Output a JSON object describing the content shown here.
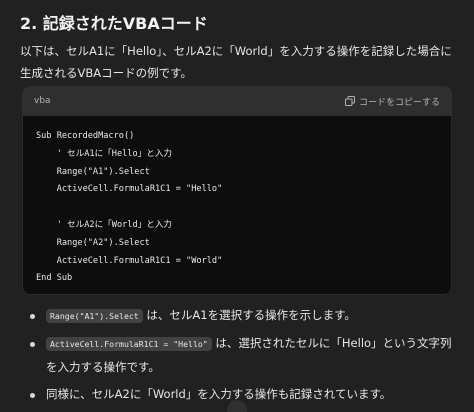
{
  "heading": "2. 記録されたVBAコード",
  "intro": "以下は、セルA1に「Hello」、セルA2に「World」を入力する操作を記録した場合に生成されるVBAコードの例です。",
  "code_block": {
    "language": "vba",
    "copy_label": "コードをコピーする",
    "code": "Sub RecordedMacro()\n    ' セルA1に「Hello」と入力\n    Range(\"A1\").Select\n    ActiveCell.FormulaR1C1 = \"Hello\"\n\n    ' セルA2に「World」と入力\n    Range(\"A2\").Select\n    ActiveCell.FormulaR1C1 = \"World\"\nEnd Sub"
  },
  "bullets": [
    {
      "code": "Range(\"A1\").Select",
      "text": " は、セルA1を選択する操作を示します。"
    },
    {
      "code": "ActiveCell.FormulaR1C1 = \"Hello\"",
      "text": " は、選択されたセルに「Hello」という文字列を入力する操作です。"
    },
    {
      "code": "",
      "text": "同様に、セルA2に「World」を入力する操作も記録されています。"
    }
  ],
  "icons": {
    "copy": "copy-icon"
  }
}
